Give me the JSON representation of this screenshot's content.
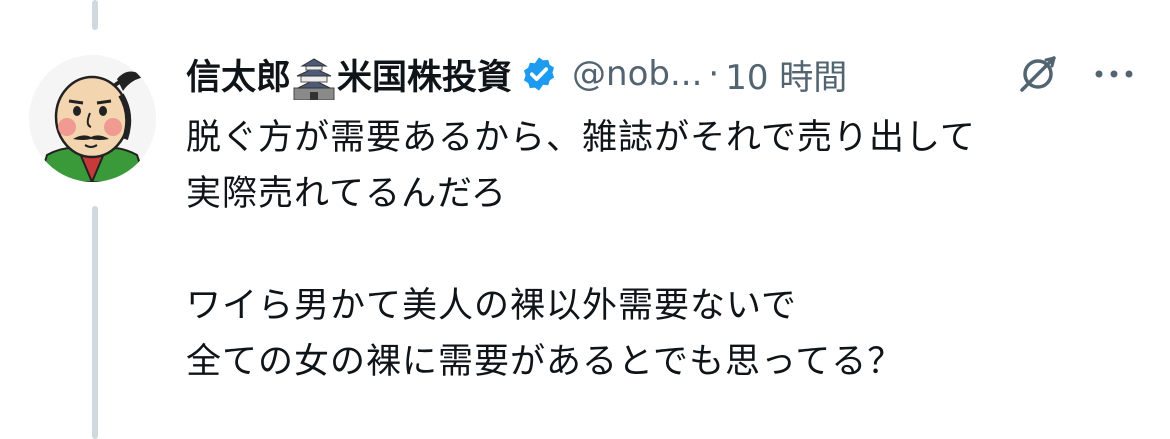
{
  "tweet": {
    "display_name_part1": "信太郎",
    "display_name_part2": "米国株投資",
    "handle": "@nob...",
    "separator": "·",
    "time": "10 時間",
    "lines": [
      "脱ぐ方が需要あるから、雑誌がそれで売り出して",
      "実際売れてるんだろ",
      "ワイら男かて美人の裸以外需要ないで",
      "全ての女の裸に需要があるとでも思ってる？"
    ]
  },
  "icons": {
    "avatar": "samurai-avatar",
    "name_emoji": "castle-icon",
    "verified": "verified-badge-icon",
    "grok": "grok-icon",
    "more": "more-icon"
  },
  "colors": {
    "text": "#0f1419",
    "secondary": "#536471",
    "verified": "#1d9bf0",
    "thread_line": "#cfd9de"
  }
}
